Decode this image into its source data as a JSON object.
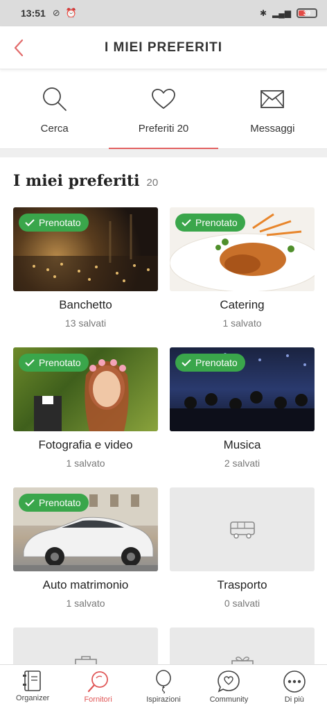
{
  "status_bar": {
    "time": "13:51",
    "battery": "39"
  },
  "header": {
    "title": "I MIEI PREFERITI"
  },
  "tabs": [
    {
      "label": "Cerca",
      "icon": "search-icon"
    },
    {
      "label": "Preferiti 20",
      "icon": "heart-icon",
      "active": true
    },
    {
      "label": "Messaggi",
      "icon": "envelope-icon"
    }
  ],
  "section": {
    "title": "I miei preferiti",
    "count": "20"
  },
  "badge_label": "Prenotato",
  "cards": [
    {
      "name": "Banchetto",
      "saved": "13 salvati",
      "booked": true
    },
    {
      "name": "Catering",
      "saved": "1 salvato",
      "booked": true
    },
    {
      "name": "Fotografia e video",
      "saved": "1 salvato",
      "booked": true
    },
    {
      "name": "Musica",
      "saved": "2 salvati",
      "booked": true
    },
    {
      "name": "Auto matrimonio",
      "saved": "1 salvato",
      "booked": true
    },
    {
      "name": "Trasporto",
      "saved": "0 salvati",
      "booked": false,
      "icon": "bus-icon"
    }
  ],
  "bottom_nav": [
    {
      "label": "Organizer",
      "icon": "notebook-icon"
    },
    {
      "label": "Fornitori",
      "icon": "search-vendors-icon",
      "active": true
    },
    {
      "label": "Ispirazioni",
      "icon": "balloon-icon"
    },
    {
      "label": "Community",
      "icon": "chat-heart-icon"
    },
    {
      "label": "Di più",
      "icon": "more-icon"
    }
  ],
  "colors": {
    "accent": "#e05656",
    "badge": "#3aa64b"
  }
}
